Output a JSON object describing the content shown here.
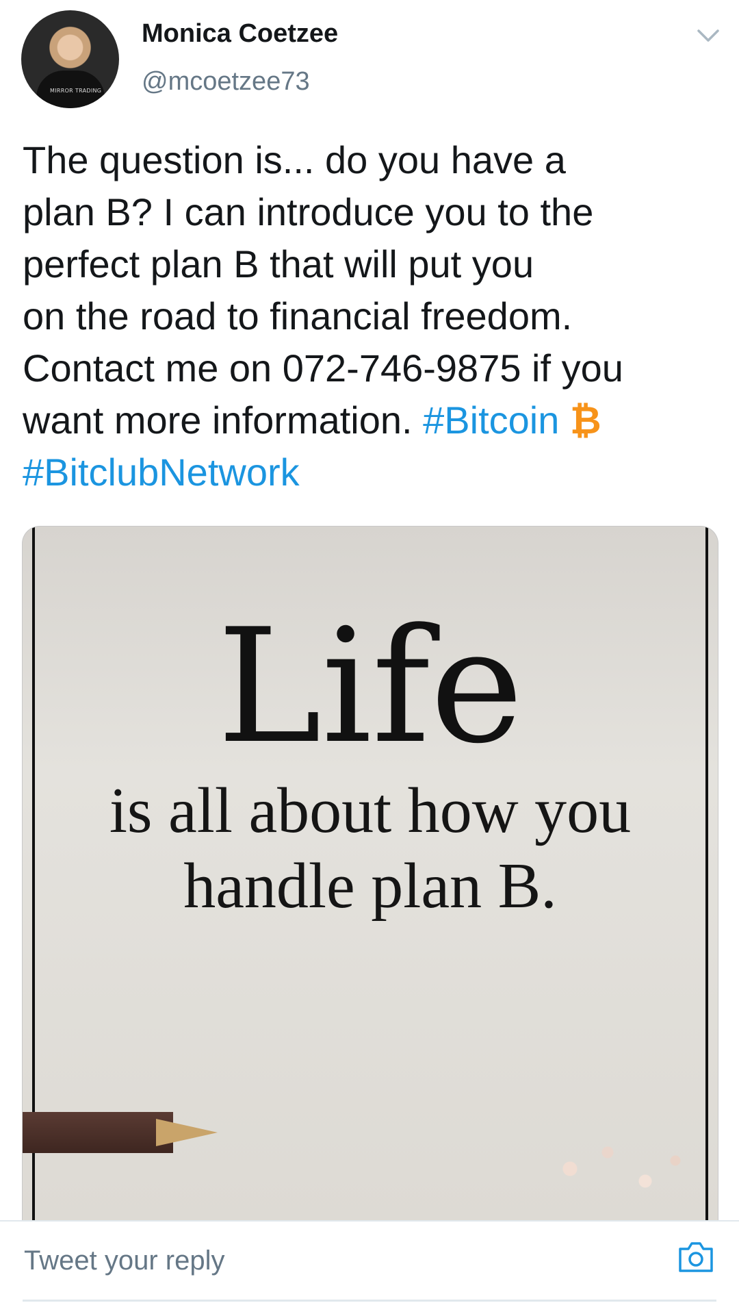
{
  "author": {
    "name": "Monica Coetzee",
    "handle": "@mcoetzee73",
    "avatar_logo_text": "MIRROR TRADING"
  },
  "tweet": {
    "lines": [
      "The question is... do you have a",
      "plan B? I can introduce you to the",
      "perfect plan B that will put you",
      "on the road to financial freedom.",
      "Contact me on 072-746-9875 if you",
      "want more information."
    ],
    "hashtag_1": "#Bitcoin",
    "bitcoin_symbol": "₿",
    "hashtag_2": "#BitclubNetwork"
  },
  "media": {
    "title": "Life",
    "line_1": "is all about how you",
    "line_2": "handle plan B."
  },
  "reply": {
    "placeholder": "Tweet your reply"
  },
  "icons": {
    "menu": "chevron-down-icon",
    "camera": "camera-icon"
  },
  "colors": {
    "hashtag": "#1b95e0",
    "bitcoin": "#f7931a",
    "handle": "#657786"
  }
}
